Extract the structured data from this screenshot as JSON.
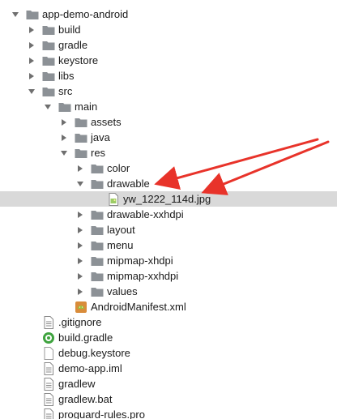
{
  "tree": [
    {
      "label": "app-demo-android",
      "depth": 0,
      "kind": "folder",
      "state": "expanded",
      "icon": "folder-icon"
    },
    {
      "label": "build",
      "depth": 1,
      "kind": "folder",
      "state": "collapsed",
      "icon": "folder-icon"
    },
    {
      "label": "gradle",
      "depth": 1,
      "kind": "folder",
      "state": "collapsed",
      "icon": "folder-icon"
    },
    {
      "label": "keystore",
      "depth": 1,
      "kind": "folder",
      "state": "collapsed",
      "icon": "folder-icon"
    },
    {
      "label": "libs",
      "depth": 1,
      "kind": "folder",
      "state": "collapsed",
      "icon": "folder-icon"
    },
    {
      "label": "src",
      "depth": 1,
      "kind": "folder",
      "state": "expanded",
      "icon": "folder-icon"
    },
    {
      "label": "main",
      "depth": 2,
      "kind": "folder",
      "state": "expanded",
      "icon": "folder-icon"
    },
    {
      "label": "assets",
      "depth": 3,
      "kind": "folder",
      "state": "collapsed",
      "icon": "folder-icon"
    },
    {
      "label": "java",
      "depth": 3,
      "kind": "folder",
      "state": "collapsed",
      "icon": "folder-icon"
    },
    {
      "label": "res",
      "depth": 3,
      "kind": "folder",
      "state": "expanded",
      "icon": "folder-icon"
    },
    {
      "label": "color",
      "depth": 4,
      "kind": "folder",
      "state": "collapsed",
      "icon": "folder-icon"
    },
    {
      "label": "drawable",
      "depth": 4,
      "kind": "folder",
      "state": "expanded",
      "icon": "folder-icon"
    },
    {
      "label": "yw_1222_114d.jpg",
      "depth": 5,
      "kind": "image",
      "state": "leaf",
      "icon": "image-file-icon",
      "selected": true
    },
    {
      "label": "drawable-xxhdpi",
      "depth": 4,
      "kind": "folder",
      "state": "collapsed",
      "icon": "folder-icon"
    },
    {
      "label": "layout",
      "depth": 4,
      "kind": "folder",
      "state": "collapsed",
      "icon": "folder-icon"
    },
    {
      "label": "menu",
      "depth": 4,
      "kind": "folder",
      "state": "collapsed",
      "icon": "folder-icon"
    },
    {
      "label": "mipmap-xhdpi",
      "depth": 4,
      "kind": "folder",
      "state": "collapsed",
      "icon": "folder-icon"
    },
    {
      "label": "mipmap-xxhdpi",
      "depth": 4,
      "kind": "folder",
      "state": "collapsed",
      "icon": "folder-icon"
    },
    {
      "label": "values",
      "depth": 4,
      "kind": "folder",
      "state": "collapsed",
      "icon": "folder-icon"
    },
    {
      "label": "AndroidManifest.xml",
      "depth": 3,
      "kind": "manifest",
      "state": "leaf",
      "icon": "android-manifest-icon"
    },
    {
      "label": ".gitignore",
      "depth": 1,
      "kind": "textfile",
      "state": "leaf",
      "icon": "text-file-icon"
    },
    {
      "label": "build.gradle",
      "depth": 1,
      "kind": "gradle",
      "state": "leaf",
      "icon": "gradle-file-icon"
    },
    {
      "label": "debug.keystore",
      "depth": 1,
      "kind": "blankfile",
      "state": "leaf",
      "icon": "file-icon"
    },
    {
      "label": "demo-app.iml",
      "depth": 1,
      "kind": "textfile",
      "state": "leaf",
      "icon": "iml-file-icon"
    },
    {
      "label": "gradlew",
      "depth": 1,
      "kind": "textfile",
      "state": "leaf",
      "icon": "text-file-icon"
    },
    {
      "label": "gradlew.bat",
      "depth": 1,
      "kind": "textfile",
      "state": "leaf",
      "icon": "text-file-icon"
    },
    {
      "label": "proguard-rules.pro",
      "depth": 1,
      "kind": "textfile",
      "state": "leaf",
      "icon": "text-file-icon"
    }
  ],
  "colors": {
    "folder": "#8c9196",
    "arrow": "#6f6f6f",
    "selection": "#d9d9d9",
    "annotation_arrow": "#e8332a",
    "gradle_green": "#3fa33f",
    "android_green": "#9fbf3b"
  }
}
